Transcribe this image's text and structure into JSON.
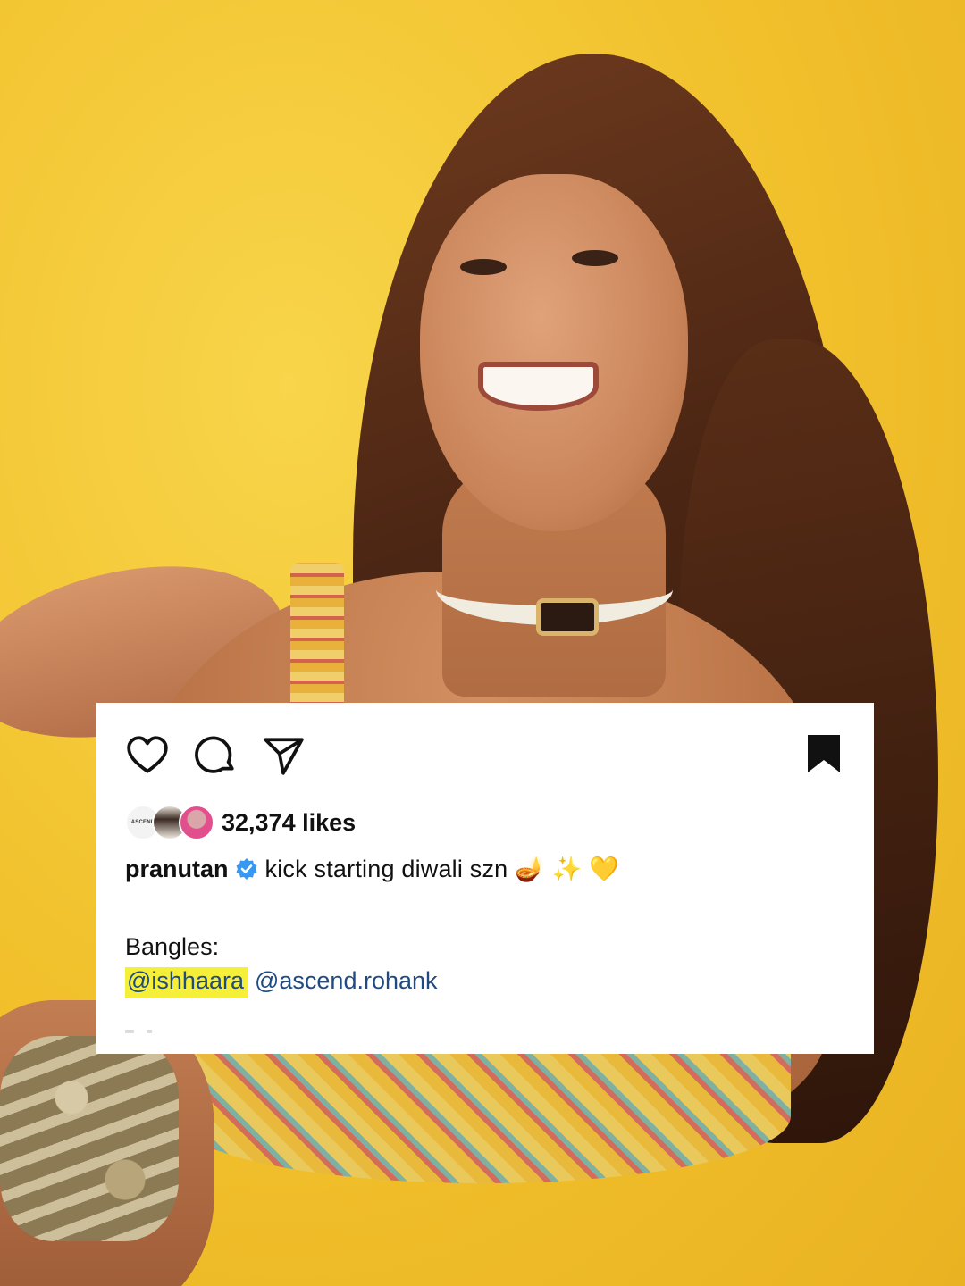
{
  "post": {
    "likes_text": "32,374 likes",
    "username": "pranutan",
    "caption": "kick starting diwali szn 🪔 ✨ 💛",
    "body_label": "Bangles:",
    "mentions": [
      "@ishhaara",
      "@ascend.rohank"
    ],
    "liker_avatar_1_text": "ASCEND"
  },
  "icons": {
    "like": "heart-icon",
    "comment": "comment-icon",
    "share": "send-icon",
    "save": "bookmark-icon",
    "verified": "verified-badge-icon"
  },
  "colors": {
    "background": "#f2c531",
    "card": "#ffffff",
    "mention": "#1f4a82",
    "highlight": "#f5ef3a",
    "verified": "#3897f0"
  }
}
